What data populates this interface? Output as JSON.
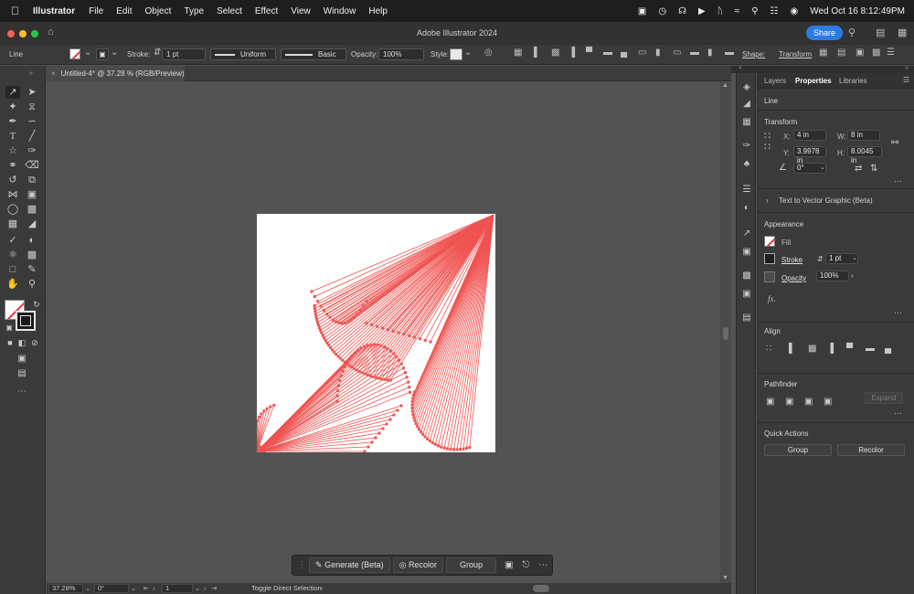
{
  "menubar": {
    "app": "Illustrator",
    "items": [
      "File",
      "Edit",
      "Object",
      "Type",
      "Select",
      "Effect",
      "View",
      "Window",
      "Help"
    ],
    "datetime": "Wed Oct 16  8:12:49PM"
  },
  "window": {
    "title": "Adobe Illustrator 2024",
    "share_label": "Share"
  },
  "controlbar": {
    "object_type": "Line",
    "stroke_label": "Stroke:",
    "stroke_value": "1 pt",
    "profile_label": "Uniform",
    "brush_label": "Basic",
    "opacity_label": "Opacity:",
    "opacity_value": "100%",
    "style_label": "Style:",
    "shape_label": "Shape:",
    "transform_label": "Transform"
  },
  "document": {
    "tab_label": "Untitled-4* @ 37.28 % (RGB/Preview)"
  },
  "context_bar": {
    "generate_label": "Generate (Beta)",
    "recolor_label": "Recolor",
    "group_label": "Group"
  },
  "statusbar": {
    "zoom": "37.28%",
    "rotation": "0°",
    "artboard": "1",
    "status_text": "Toggle Direct Selection"
  },
  "panel": {
    "tabs": [
      "Layers",
      "Properties",
      "Libraries"
    ],
    "active_tab": "Properties",
    "selection_type": "Line",
    "transform": {
      "title": "Transform",
      "x_label": "X:",
      "x_value": "4 in",
      "y_label": "Y:",
      "y_value": "3.9978 in",
      "w_label": "W:",
      "w_value": "8 in",
      "h_label": "H:",
      "h_value": "8.0045 in",
      "angle_value": "0°"
    },
    "text_to_vector": "Text to Vector Graphic (Beta)",
    "appearance": {
      "title": "Appearance",
      "fill_label": "Fill",
      "stroke_label": "Stroke",
      "stroke_value": "1 pt",
      "opacity_label": "Opacity",
      "opacity_value": "100%",
      "fx_label": "fx."
    },
    "align": {
      "title": "Align"
    },
    "pathfinder": {
      "title": "Pathfinder",
      "expand_label": "Expand"
    },
    "quick_actions": {
      "title": "Quick Actions",
      "group_label": "Group",
      "recolor_label": "Recolor"
    }
  },
  "colors": {
    "line_color": "#ef5350",
    "accent": "#2c7be5"
  }
}
